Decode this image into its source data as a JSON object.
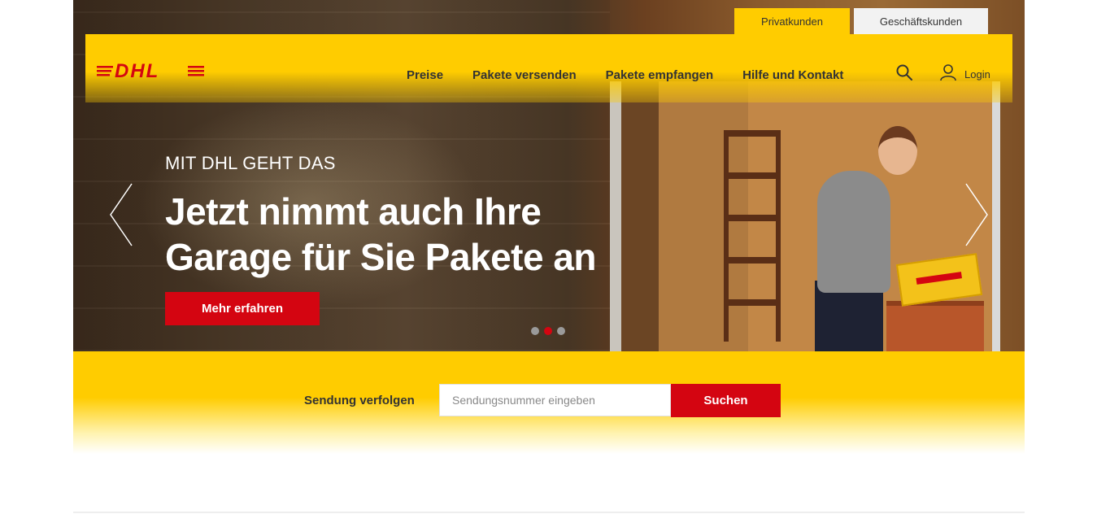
{
  "tabs": {
    "private_label": "Privatkunden",
    "business_label": "Geschäftskunden"
  },
  "header": {
    "logo_text": "DHL",
    "nav": [
      "Preise",
      "Pakete versenden",
      "Pakete empfangen",
      "Hilfe und Kontakt"
    ],
    "login_label": "Login"
  },
  "hero": {
    "eyebrow": "MIT DHL GEHT DAS",
    "headline": "Jetzt nimmt auch Ihre Garage für Sie Pakete an",
    "cta_label": "Mehr erfahren",
    "slides_total": 3,
    "active_slide": 2
  },
  "tracking": {
    "label": "Sendung verfolgen",
    "placeholder": "Sendungsnummer eingeben",
    "button_label": "Suchen"
  },
  "colors": {
    "brand_yellow": "#ffcc00",
    "brand_red": "#d40511"
  },
  "icons": [
    "search-icon",
    "user-icon",
    "chevron-left-icon",
    "chevron-right-icon"
  ]
}
